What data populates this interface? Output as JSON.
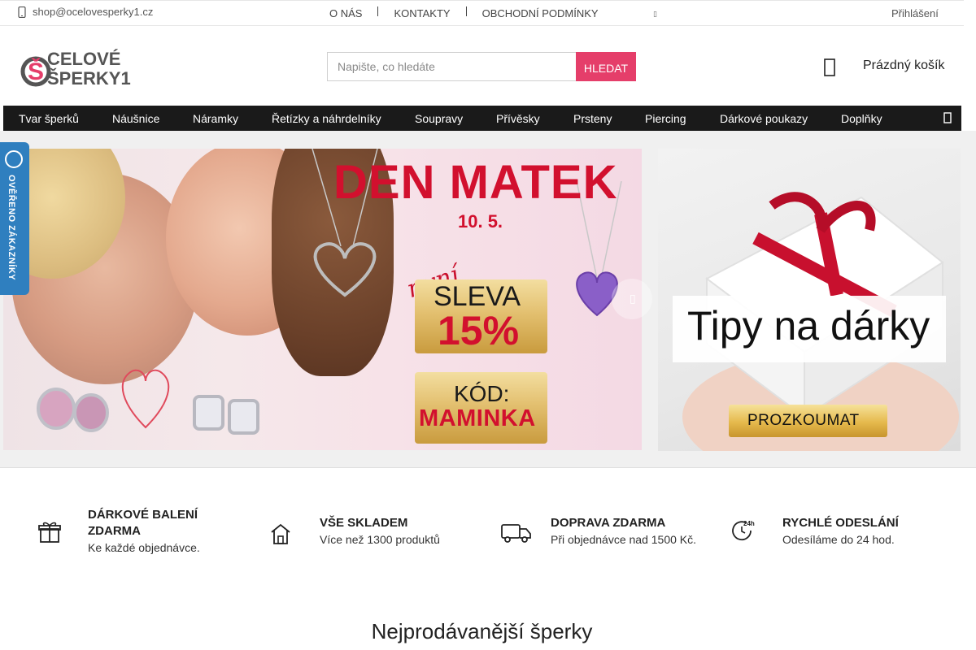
{
  "topbar": {
    "email": "shop@ocelovesperky1.cz",
    "links": [
      "O NÁS",
      "KONTAKTY",
      "OBCHODNÍ PODMÍNKY"
    ],
    "login": "Přihlášení"
  },
  "header": {
    "logo_text_top": "CELOVÉ",
    "logo_text_bottom": "ŠPERKY1",
    "search_placeholder": "Napište, co hledáte",
    "search_button": "HLEDAT",
    "cart_label": "Prázdný košík"
  },
  "nav": {
    "items": [
      "Tvar šperků",
      "Náušnice",
      "Náramky",
      "Řetízky a náhrdelníky",
      "Soupravy",
      "Přívěsky",
      "Prsteny",
      "Piercing",
      "Dárkové poukazy",
      "Doplňky"
    ]
  },
  "verified_badge": {
    "text": "OVĚŘENO ZÁKAZNÍKY"
  },
  "slider": {
    "title": "DEN MATEK",
    "date": "10. 5.",
    "nyni": "nyní",
    "sleva": "SLEVA",
    "percent": "15%",
    "kod_label": "KÓD:",
    "code": "MAMINKA"
  },
  "side_banner": {
    "title": "Tipy na dárky",
    "button": "PROZKOUMAT"
  },
  "features": [
    {
      "icon": "gift-icon",
      "title": "DÁRKOVÉ BALENÍ ZDARMA",
      "subtitle": "Ke každé objednávce."
    },
    {
      "icon": "home-icon",
      "title": "VŠE SKLADEM",
      "subtitle": "Více než 1300 produktů"
    },
    {
      "icon": "truck-icon",
      "title": "DOPRAVA ZDARMA",
      "subtitle": "Při objednávce nad 1500 Kč."
    },
    {
      "icon": "clock-24-icon",
      "title": "RYCHLÉ ODESLÁNÍ",
      "subtitle": "Odesíláme do 24 hod."
    }
  ],
  "section": {
    "bestsellers_title": "Nejprodávanější šperky"
  },
  "colors": {
    "accent": "#e53e6a",
    "nav_bg": "#1a1a1a",
    "promo_red": "#d2102e",
    "badge_blue": "#2f7fbf"
  }
}
